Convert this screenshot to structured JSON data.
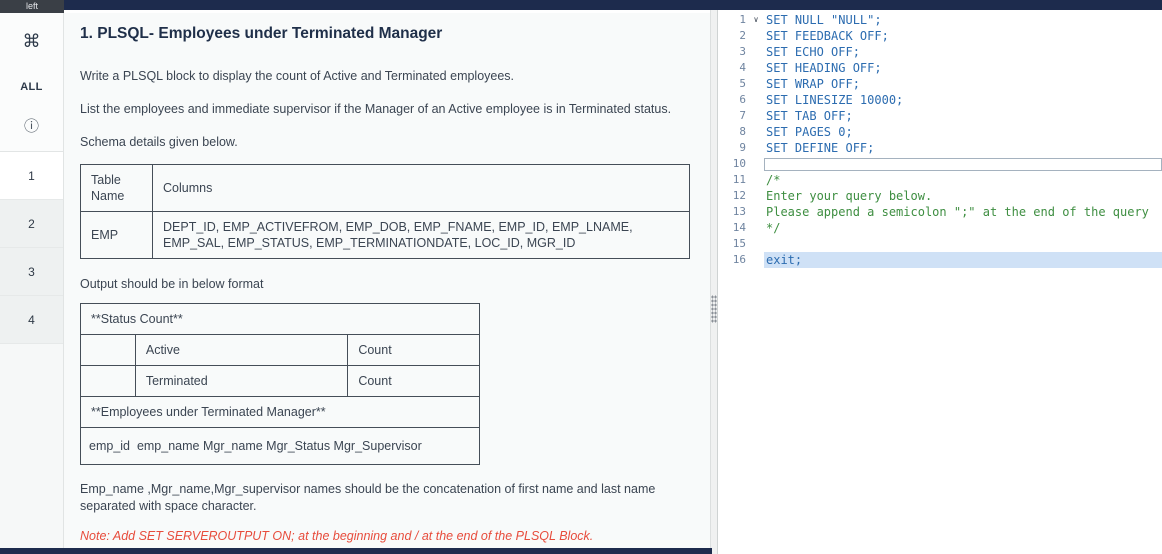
{
  "chrome": {
    "topbar_color": "#1d2b4d",
    "note_color": "#e74c3c"
  },
  "topbar": {
    "tab_label": "left"
  },
  "sidebar": {
    "command_icon": "⌘",
    "all_label": "ALL",
    "info_icon": "ⓘ",
    "items": [
      "1",
      "2",
      "3",
      "4"
    ],
    "active_item": "1"
  },
  "question": {
    "title": "1. PLSQL- Employees under Terminated Manager",
    "paragraphs": [
      "Write a PLSQL block to display the count of Active and Terminated employees.",
      "List the employees  and immediate supervisor if the Manager of an Active employee is in  Terminated status.",
      "Schema details given below."
    ],
    "schema_table": {
      "headers": [
        "Table Name",
        "Columns"
      ],
      "rows": [
        [
          "EMP",
          "DEPT_ID, EMP_ACTIVEFROM, EMP_DOB, EMP_FNAME, EMP_ID, EMP_LNAME, EMP_SAL, EMP_STATUS, EMP_TERMINATIONDATE, LOC_ID, MGR_ID"
        ]
      ]
    },
    "output_intro": "Output should be in below format",
    "output_table": {
      "title_row": "**Status Count**",
      "status_rows": [
        {
          "col1": "",
          "col2": "Active",
          "col3": "Count"
        },
        {
          "col1": "",
          "col2": "Terminated",
          "col3": "Count"
        }
      ],
      "section_row": "**Employees under Terminated Manager**",
      "columns_row": "emp_id  emp_name Mgr_name Mgr_Status Mgr_Supervisor"
    },
    "concat_note": "Emp_name ,Mgr_name,Mgr_supervisor names  should be  the concatenation of first name and last name separated with space character.",
    "red_note": "Note: Add SET SERVEROUTPUT ON; at the beginning and / at the end of the PLSQL Block."
  },
  "editor": {
    "colors": {
      "code": "#2c6cb0",
      "comment": "#3e8e41",
      "highlight_bg": "#cfe1f6"
    },
    "lines": [
      {
        "num": 1,
        "text": "SET NULL \"NULL\";",
        "type": "code",
        "fold": true
      },
      {
        "num": 2,
        "text": "SET FEEDBACK OFF;",
        "type": "code"
      },
      {
        "num": 3,
        "text": "SET ECHO OFF;",
        "type": "code"
      },
      {
        "num": 4,
        "text": "SET HEADING OFF;",
        "type": "code"
      },
      {
        "num": 5,
        "text": "SET WRAP OFF;",
        "type": "code"
      },
      {
        "num": 6,
        "text": "SET LINESIZE 10000;",
        "type": "code"
      },
      {
        "num": 7,
        "text": "SET TAB OFF;",
        "type": "code"
      },
      {
        "num": 8,
        "text": "SET PAGES 0;",
        "type": "code"
      },
      {
        "num": 9,
        "text": "SET DEFINE OFF;",
        "type": "code"
      },
      {
        "num": 10,
        "text": "",
        "type": "cursor"
      },
      {
        "num": 11,
        "text": "/*",
        "type": "comment"
      },
      {
        "num": 12,
        "text": "Enter your query below.",
        "type": "comment"
      },
      {
        "num": 13,
        "text": "Please append a semicolon \";\" at the end of the query",
        "type": "comment"
      },
      {
        "num": 14,
        "text": "*/",
        "type": "comment"
      },
      {
        "num": 15,
        "text": "",
        "type": "empty"
      },
      {
        "num": 16,
        "text": "exit;",
        "type": "code",
        "highlight": true
      }
    ]
  }
}
